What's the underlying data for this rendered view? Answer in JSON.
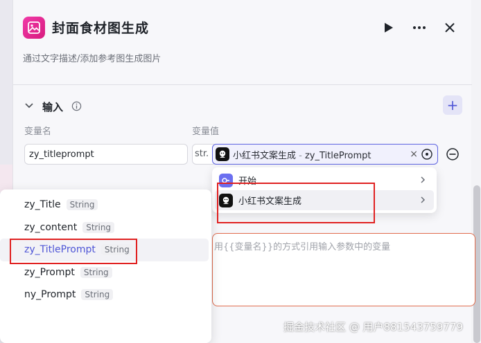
{
  "node": {
    "title": "封面食材图生成",
    "description": "通过文字描述/添加参考图生成图片",
    "icon": "image-icon",
    "accent": "#e0247f"
  },
  "input_section": {
    "title": "输入",
    "col_name": "变量名",
    "col_value": "变量值",
    "row": {
      "name_value": "zy_titleprompt",
      "type_label": "str.",
      "ref_node": "小红书文案生成",
      "ref_sep": " - ",
      "ref_var": "zy_TitlePrompt",
      "clear_label": "×"
    }
  },
  "node_dropdown": {
    "items": [
      {
        "label": "开始",
        "icon": "start-icon"
      },
      {
        "label": "小红书文案生成",
        "icon": "xiaohongshu-icon"
      }
    ]
  },
  "editor": {
    "placeholder": "用{{变量名}}的方式引用输入参数中的变量"
  },
  "var_dropdown": {
    "items": [
      {
        "name": "zy_Title",
        "type": "String"
      },
      {
        "name": "zy_content",
        "type": "String"
      },
      {
        "name": "zy_TitlePrompt",
        "type": "String",
        "active": true
      },
      {
        "name": "zy_Prompt",
        "type": "String"
      },
      {
        "name": "ny_Prompt",
        "type": "String"
      }
    ]
  },
  "watermark": "掘金技术社区 @ 用户881543759779",
  "colors": {
    "primary": "#4e55d6",
    "annotation": "#e02020",
    "editor_border": "#e06a4b"
  }
}
